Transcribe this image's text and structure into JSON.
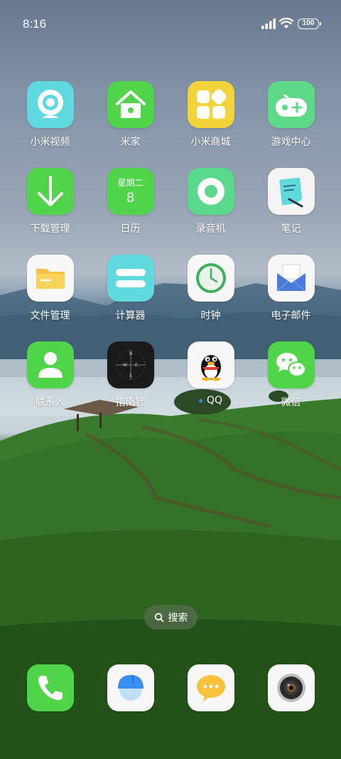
{
  "status_bar": {
    "time": "8:16",
    "battery": "100"
  },
  "home": {
    "apps": [
      {
        "label": "小米视频",
        "icon": "camera-icon",
        "color": "#5fd8de"
      },
      {
        "label": "米家",
        "icon": "home-icon",
        "color": "#4fd44a"
      },
      {
        "label": "小米商城",
        "icon": "shop-grid-icon",
        "color": "#f3d33a"
      },
      {
        "label": "游戏中心",
        "icon": "gamepad-icon",
        "color": "#5dd987"
      },
      {
        "label": "下载管理",
        "icon": "download-icon",
        "color": "#4fd44a"
      },
      {
        "label": "日历",
        "icon": "calendar-icon",
        "color": "#4fd44a",
        "weekday": "星期二",
        "day": "8"
      },
      {
        "label": "录音机",
        "icon": "recorder-icon",
        "color": "#5ad98c"
      },
      {
        "label": "笔记",
        "icon": "note-icon",
        "color": "#f4f4f4"
      },
      {
        "label": "文件管理",
        "icon": "folder-icon",
        "color": "#f7f7f7"
      },
      {
        "label": "计算器",
        "icon": "calculator-icon",
        "color": "#5fd8de"
      },
      {
        "label": "时钟",
        "icon": "clock-icon",
        "color": "#f7f7f7"
      },
      {
        "label": "电子邮件",
        "icon": "mail-icon",
        "color": "#f7f7f7"
      },
      {
        "label": "联系人",
        "icon": "contact-icon",
        "color": "#4fd44a"
      },
      {
        "label": "指南针",
        "icon": "compass-icon",
        "color": "#1a1a1a"
      },
      {
        "label": "QQ",
        "icon": "qq-penguin-icon",
        "color": "#f7f7f7"
      },
      {
        "label": "微信",
        "icon": "wechat-icon",
        "color": "#4fd44a"
      }
    ]
  },
  "search": {
    "label": "搜索"
  },
  "dock": [
    {
      "icon": "phone-icon",
      "color": "#4fd44a"
    },
    {
      "icon": "browser-icon",
      "color": "#f7f7f7"
    },
    {
      "icon": "message-icon",
      "color": "#f7f7f7"
    },
    {
      "icon": "camera-lens-icon",
      "color": "#f7f7f7"
    }
  ]
}
